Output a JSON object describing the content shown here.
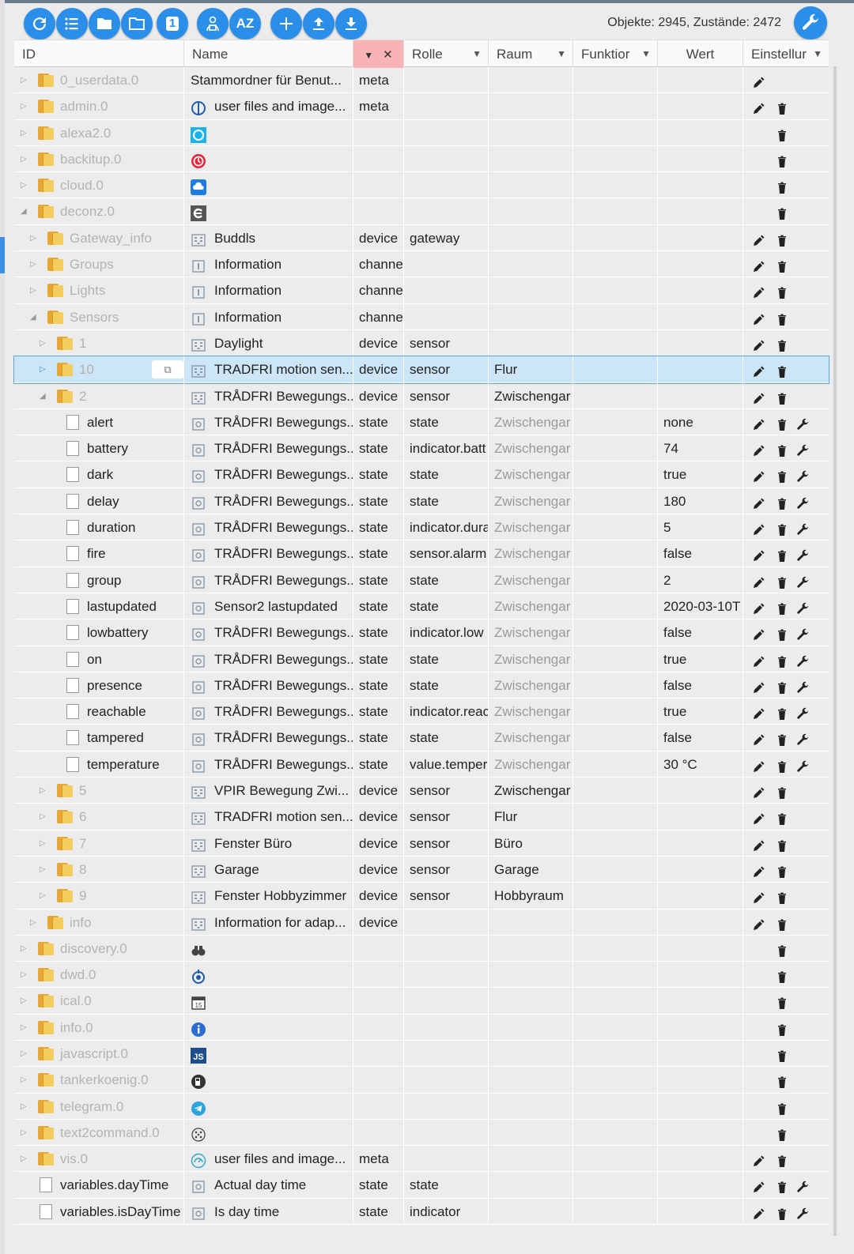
{
  "toolbar": {
    "buttons": [
      {
        "name": "refresh-button",
        "icon": "refresh-icon"
      },
      {
        "name": "list-view-button",
        "icon": "list-icon"
      },
      {
        "name": "folder-button",
        "icon": "folder-icon"
      },
      {
        "name": "folder-outline-button",
        "icon": "folder-outline-icon"
      },
      {
        "name": "one-level-button",
        "icon": "one-icon",
        "label": "1"
      },
      {
        "name": "expert-button",
        "icon": "person-icon"
      },
      {
        "name": "sort-az-button",
        "icon": "az-icon",
        "label": "AZ"
      },
      {
        "name": "add-button",
        "icon": "plus-icon"
      },
      {
        "name": "upload-button",
        "icon": "upload-icon"
      },
      {
        "name": "download-button",
        "icon": "download-icon"
      }
    ],
    "counts": "Objekte: 2945, Zustände: 2472"
  },
  "header": {
    "id": "ID",
    "name": "Name",
    "role": "Rolle",
    "room": "Raum",
    "func": "Funktior",
    "value": "Wert",
    "settings": "Einstellur",
    "filter_clear": "✕"
  },
  "colors": {
    "accent": "#2b8fea",
    "folder": "#f4cd5f",
    "filter_bg": "#f8b4b4",
    "selected_row": "#cde6f7"
  },
  "rows": [
    {
      "level": 0,
      "exp": "right",
      "kind": "folder",
      "id": "0_userdata.0",
      "grey": true,
      "icon": "none",
      "name": "Stammordner für Benut...",
      "type": "meta",
      "role": "",
      "room": "",
      "roomGrey": false,
      "value": "",
      "edit": true,
      "del": false,
      "wrench": false
    },
    {
      "level": 0,
      "exp": "right",
      "kind": "folder",
      "id": "admin.0",
      "grey": true,
      "icon": "admin-icon",
      "name": "user files and image...",
      "type": "meta",
      "role": "",
      "room": "",
      "roomGrey": false,
      "value": "",
      "edit": true,
      "del": true,
      "wrench": false
    },
    {
      "level": 0,
      "exp": "right",
      "kind": "folder",
      "id": "alexa2.0",
      "grey": true,
      "icon": "alexa-icon",
      "name": "",
      "type": "",
      "role": "",
      "room": "",
      "roomGrey": false,
      "value": "",
      "edit": false,
      "del": true,
      "wrench": false
    },
    {
      "level": 0,
      "exp": "right",
      "kind": "folder",
      "id": "backitup.0",
      "grey": true,
      "icon": "backitup-icon",
      "name": "",
      "type": "",
      "role": "",
      "room": "",
      "roomGrey": false,
      "value": "",
      "edit": false,
      "del": true,
      "wrench": false
    },
    {
      "level": 0,
      "exp": "right",
      "kind": "folder",
      "id": "cloud.0",
      "grey": true,
      "icon": "cloud-icon",
      "name": "",
      "type": "",
      "role": "",
      "room": "",
      "roomGrey": false,
      "value": "",
      "edit": false,
      "del": true,
      "wrench": false
    },
    {
      "level": 0,
      "exp": "down",
      "kind": "folder",
      "id": "deconz.0",
      "grey": true,
      "icon": "deconz-icon",
      "name": "",
      "type": "",
      "role": "",
      "room": "",
      "roomGrey": false,
      "value": "",
      "edit": false,
      "del": true,
      "wrench": false
    },
    {
      "level": 1,
      "exp": "right",
      "kind": "folder",
      "id": "Gateway_info",
      "grey": true,
      "icon": "device-icon",
      "name": "Buddls",
      "type": "device",
      "role": "gateway",
      "room": "",
      "roomGrey": false,
      "value": "",
      "edit": true,
      "del": true,
      "wrench": false
    },
    {
      "level": 1,
      "exp": "right",
      "kind": "folder",
      "id": "Groups",
      "grey": true,
      "icon": "channel-icon",
      "name": "Information",
      "type": "channe",
      "role": "",
      "room": "",
      "roomGrey": false,
      "value": "",
      "edit": true,
      "del": true,
      "wrench": false
    },
    {
      "level": 1,
      "exp": "right",
      "kind": "folder",
      "id": "Lights",
      "grey": true,
      "icon": "channel-icon",
      "name": "Information",
      "type": "channe",
      "role": "",
      "room": "",
      "roomGrey": false,
      "value": "",
      "edit": true,
      "del": true,
      "wrench": false
    },
    {
      "level": 1,
      "exp": "down",
      "kind": "folder",
      "id": "Sensors",
      "grey": true,
      "icon": "channel-icon",
      "name": "Information",
      "type": "channe",
      "role": "",
      "room": "",
      "roomGrey": false,
      "value": "",
      "edit": true,
      "del": true,
      "wrench": false
    },
    {
      "level": 2,
      "exp": "right",
      "kind": "folder",
      "id": "1",
      "grey": true,
      "icon": "device-icon",
      "name": "Daylight",
      "type": "device",
      "role": "sensor",
      "room": "",
      "roomGrey": false,
      "value": "",
      "edit": true,
      "del": true,
      "wrench": false
    },
    {
      "level": 2,
      "exp": "right",
      "kind": "folder",
      "id": "10",
      "grey": true,
      "icon": "device-icon",
      "name": "TRADFRI motion sen...",
      "type": "device",
      "role": "sensor",
      "room": "Flur",
      "roomGrey": false,
      "value": "",
      "edit": true,
      "del": true,
      "wrench": false,
      "selected": true
    },
    {
      "level": 2,
      "exp": "down",
      "kind": "folder",
      "id": "2",
      "grey": true,
      "icon": "device-icon",
      "name": "TRÅDFRI Bewegungs...",
      "type": "device",
      "role": "sensor",
      "room": "Zwischengar",
      "roomGrey": false,
      "value": "",
      "edit": true,
      "del": true,
      "wrench": false
    },
    {
      "level": 3,
      "exp": "",
      "kind": "doc",
      "id": "alert",
      "grey": false,
      "icon": "state-icon",
      "name": "TRÅDFRI Bewegungs...",
      "type": "state",
      "role": "state",
      "room": "Zwischengar",
      "roomGrey": true,
      "value": "none",
      "edit": true,
      "del": true,
      "wrench": true
    },
    {
      "level": 3,
      "exp": "",
      "kind": "doc",
      "id": "battery",
      "grey": false,
      "icon": "state-icon",
      "name": "TRÅDFRI Bewegungs...",
      "type": "state",
      "role": "indicator.batt",
      "room": "Zwischengar",
      "roomGrey": true,
      "value": "74",
      "edit": true,
      "del": true,
      "wrench": true
    },
    {
      "level": 3,
      "exp": "",
      "kind": "doc",
      "id": "dark",
      "grey": false,
      "icon": "state-icon",
      "name": "TRÅDFRI Bewegungs...",
      "type": "state",
      "role": "state",
      "room": "Zwischengar",
      "roomGrey": true,
      "value": "true",
      "edit": true,
      "del": true,
      "wrench": true
    },
    {
      "level": 3,
      "exp": "",
      "kind": "doc",
      "id": "delay",
      "grey": false,
      "icon": "state-icon",
      "name": "TRÅDFRI Bewegungs...",
      "type": "state",
      "role": "state",
      "room": "Zwischengar",
      "roomGrey": true,
      "value": "180",
      "edit": true,
      "del": true,
      "wrench": true
    },
    {
      "level": 3,
      "exp": "",
      "kind": "doc",
      "id": "duration",
      "grey": false,
      "icon": "state-icon",
      "name": "TRÅDFRI Bewegungs...",
      "type": "state",
      "role": "indicator.dura",
      "room": "Zwischengar",
      "roomGrey": true,
      "value": "5",
      "edit": true,
      "del": true,
      "wrench": true
    },
    {
      "level": 3,
      "exp": "",
      "kind": "doc",
      "id": "fire",
      "grey": false,
      "icon": "state-icon",
      "name": "TRÅDFRI Bewegungs...",
      "type": "state",
      "role": "sensor.alarm",
      "room": "Zwischengar",
      "roomGrey": true,
      "value": "false",
      "edit": true,
      "del": true,
      "wrench": true
    },
    {
      "level": 3,
      "exp": "",
      "kind": "doc",
      "id": "group",
      "grey": false,
      "icon": "state-icon",
      "name": "TRÅDFRI Bewegungs...",
      "type": "state",
      "role": "state",
      "room": "Zwischengar",
      "roomGrey": true,
      "value": "2",
      "edit": true,
      "del": true,
      "wrench": true
    },
    {
      "level": 3,
      "exp": "",
      "kind": "doc",
      "id": "lastupdated",
      "grey": false,
      "icon": "state-icon",
      "name": "Sensor2 lastupdated",
      "type": "state",
      "role": "state",
      "room": "Zwischengar",
      "roomGrey": true,
      "value": "2020-03-10T",
      "edit": true,
      "del": true,
      "wrench": true
    },
    {
      "level": 3,
      "exp": "",
      "kind": "doc",
      "id": "lowbattery",
      "grey": false,
      "icon": "state-icon",
      "name": "TRÅDFRI Bewegungs...",
      "type": "state",
      "role": "indicator.low",
      "room": "Zwischengar",
      "roomGrey": true,
      "value": "false",
      "edit": true,
      "del": true,
      "wrench": true
    },
    {
      "level": 3,
      "exp": "",
      "kind": "doc",
      "id": "on",
      "grey": false,
      "icon": "state-icon",
      "name": "TRÅDFRI Bewegungs...",
      "type": "state",
      "role": "state",
      "room": "Zwischengar",
      "roomGrey": true,
      "value": "true",
      "edit": true,
      "del": true,
      "wrench": true
    },
    {
      "level": 3,
      "exp": "",
      "kind": "doc",
      "id": "presence",
      "grey": false,
      "icon": "state-icon",
      "name": "TRÅDFRI Bewegungs...",
      "type": "state",
      "role": "state",
      "room": "Zwischengar",
      "roomGrey": true,
      "value": "false",
      "edit": true,
      "del": true,
      "wrench": true
    },
    {
      "level": 3,
      "exp": "",
      "kind": "doc",
      "id": "reachable",
      "grey": false,
      "icon": "state-icon",
      "name": "TRÅDFRI Bewegungs...",
      "type": "state",
      "role": "indicator.reac",
      "room": "Zwischengar",
      "roomGrey": true,
      "value": "true",
      "edit": true,
      "del": true,
      "wrench": true
    },
    {
      "level": 3,
      "exp": "",
      "kind": "doc",
      "id": "tampered",
      "grey": false,
      "icon": "state-icon",
      "name": "TRÅDFRI Bewegungs...",
      "type": "state",
      "role": "state",
      "room": "Zwischengar",
      "roomGrey": true,
      "value": "false",
      "edit": true,
      "del": true,
      "wrench": true
    },
    {
      "level": 3,
      "exp": "",
      "kind": "doc",
      "id": "temperature",
      "grey": false,
      "icon": "state-icon",
      "name": "TRÅDFRI Bewegungs...",
      "type": "state",
      "role": "value.temper",
      "room": "Zwischengar",
      "roomGrey": true,
      "value": "30 °C",
      "edit": true,
      "del": true,
      "wrench": true
    },
    {
      "level": 2,
      "exp": "right",
      "kind": "folder",
      "id": "5",
      "grey": true,
      "icon": "device-icon",
      "name": "VPIR Bewegung Zwi...",
      "type": "device",
      "role": "sensor",
      "room": "Zwischengar",
      "roomGrey": false,
      "value": "",
      "edit": true,
      "del": true,
      "wrench": false
    },
    {
      "level": 2,
      "exp": "right",
      "kind": "folder",
      "id": "6",
      "grey": true,
      "icon": "device-icon",
      "name": "TRADFRI motion sen...",
      "type": "device",
      "role": "sensor",
      "room": "Flur",
      "roomGrey": false,
      "value": "",
      "edit": true,
      "del": true,
      "wrench": false
    },
    {
      "level": 2,
      "exp": "right",
      "kind": "folder",
      "id": "7",
      "grey": true,
      "icon": "device-icon",
      "name": "Fenster Büro",
      "type": "device",
      "role": "sensor",
      "room": "Büro",
      "roomGrey": false,
      "value": "",
      "edit": true,
      "del": true,
      "wrench": false
    },
    {
      "level": 2,
      "exp": "right",
      "kind": "folder",
      "id": "8",
      "grey": true,
      "icon": "device-icon",
      "name": "Garage",
      "type": "device",
      "role": "sensor",
      "room": "Garage",
      "roomGrey": false,
      "value": "",
      "edit": true,
      "del": true,
      "wrench": false
    },
    {
      "level": 2,
      "exp": "right",
      "kind": "folder",
      "id": "9",
      "grey": true,
      "icon": "device-icon",
      "name": "Fenster Hobbyzimmer",
      "type": "device",
      "role": "sensor",
      "room": "Hobbyraum",
      "roomGrey": false,
      "value": "",
      "edit": true,
      "del": true,
      "wrench": false
    },
    {
      "level": 1,
      "exp": "right",
      "kind": "folder",
      "id": "info",
      "grey": true,
      "icon": "device-icon",
      "name": "Information for adap...",
      "type": "device",
      "role": "",
      "room": "",
      "roomGrey": false,
      "value": "",
      "edit": true,
      "del": true,
      "wrench": false
    },
    {
      "level": 0,
      "exp": "right",
      "kind": "folder",
      "id": "discovery.0",
      "grey": true,
      "icon": "discovery-icon",
      "name": "",
      "type": "",
      "role": "",
      "room": "",
      "roomGrey": false,
      "value": "",
      "edit": false,
      "del": true,
      "wrench": false
    },
    {
      "level": 0,
      "exp": "right",
      "kind": "folder",
      "id": "dwd.0",
      "grey": true,
      "icon": "dwd-icon",
      "name": "",
      "type": "",
      "role": "",
      "room": "",
      "roomGrey": false,
      "value": "",
      "edit": false,
      "del": true,
      "wrench": false
    },
    {
      "level": 0,
      "exp": "right",
      "kind": "folder",
      "id": "ical.0",
      "grey": true,
      "icon": "ical-icon",
      "name": "",
      "type": "",
      "role": "",
      "room": "",
      "roomGrey": false,
      "value": "",
      "edit": false,
      "del": true,
      "wrench": false
    },
    {
      "level": 0,
      "exp": "right",
      "kind": "folder",
      "id": "info.0",
      "grey": true,
      "icon": "info-icon",
      "name": "",
      "type": "",
      "role": "",
      "room": "",
      "roomGrey": false,
      "value": "",
      "edit": false,
      "del": true,
      "wrench": false
    },
    {
      "level": 0,
      "exp": "right",
      "kind": "folder",
      "id": "javascript.0",
      "grey": true,
      "icon": "javascript-icon",
      "name": "",
      "type": "",
      "role": "",
      "room": "",
      "roomGrey": false,
      "value": "",
      "edit": false,
      "del": true,
      "wrench": false
    },
    {
      "level": 0,
      "exp": "right",
      "kind": "folder",
      "id": "tankerkoenig.0",
      "grey": true,
      "icon": "fuel-icon",
      "name": "",
      "type": "",
      "role": "",
      "room": "",
      "roomGrey": false,
      "value": "",
      "edit": false,
      "del": true,
      "wrench": false
    },
    {
      "level": 0,
      "exp": "right",
      "kind": "folder",
      "id": "telegram.0",
      "grey": true,
      "icon": "telegram-icon",
      "name": "",
      "type": "",
      "role": "",
      "room": "",
      "roomGrey": false,
      "value": "",
      "edit": false,
      "del": true,
      "wrench": false
    },
    {
      "level": 0,
      "exp": "right",
      "kind": "folder",
      "id": "text2command.0",
      "grey": true,
      "icon": "text2command-icon",
      "name": "",
      "type": "",
      "role": "",
      "room": "",
      "roomGrey": false,
      "value": "",
      "edit": false,
      "del": true,
      "wrench": false
    },
    {
      "level": 0,
      "exp": "right",
      "kind": "folder",
      "id": "vis.0",
      "grey": true,
      "icon": "vis-icon",
      "name": "user files and image...",
      "type": "meta",
      "role": "",
      "room": "",
      "roomGrey": false,
      "value": "",
      "edit": true,
      "del": true,
      "wrench": false
    },
    {
      "level": 0,
      "exp": "",
      "kind": "doc",
      "id": "variables.dayTime",
      "grey": false,
      "icon": "state-icon",
      "name": "Actual day time",
      "type": "state",
      "role": "state",
      "room": "",
      "roomGrey": false,
      "value": "",
      "edit": true,
      "del": true,
      "wrench": true
    },
    {
      "level": 0,
      "exp": "",
      "kind": "doc",
      "id": "variables.isDayTime",
      "grey": false,
      "icon": "state-icon",
      "name": "Is day time",
      "type": "state",
      "role": "indicator",
      "room": "",
      "roomGrey": false,
      "value": "",
      "edit": true,
      "del": true,
      "wrench": true
    }
  ]
}
